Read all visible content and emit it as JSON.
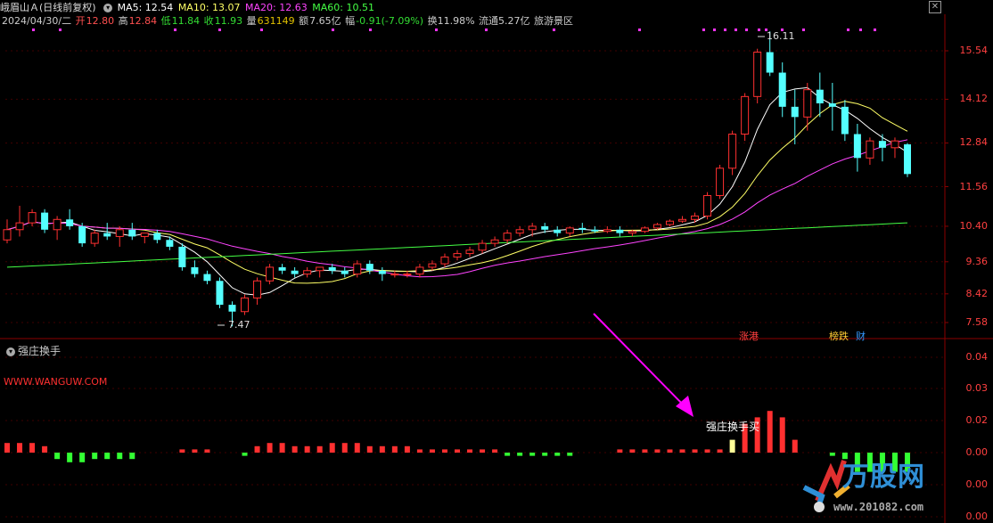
{
  "header": {
    "stock_name": "峨眉山Ａ(日线前复权)",
    "ma5": "MA5: 12.54",
    "ma10": "MA10: 13.07",
    "ma20": "MA20: 12.63",
    "ma60": "MA60: 10.51",
    "close_symbol": "✕"
  },
  "info": {
    "date": "2024/04/30/二",
    "open_label": "开",
    "open": "12.80",
    "high_label": "高",
    "high": "12.84",
    "low_label": "低",
    "low": "11.84",
    "close_label": "收",
    "close": "11.93",
    "volume_label": "量",
    "volume": "631149",
    "amount_label": "额",
    "amount": "7.65亿",
    "change_label": "幅",
    "change": "-0.91(-7.09%)",
    "turnover": "换11.98%",
    "float": "流通5.27亿",
    "sector": "旅游景区"
  },
  "price_axis": [
    "15.54",
    "14.12",
    "12.84",
    "11.56",
    "10.40",
    "9.36",
    "8.42",
    "7.58"
  ],
  "indicator_axis": [
    "0.04",
    "0.03",
    "0.02",
    "0.00",
    "0.00",
    "0.00"
  ],
  "annotations": {
    "high_marker": "16.11",
    "low_marker": "7.47",
    "badge_zt": "涨港",
    "badge_bd": "榜跌",
    "badge_cai": "财",
    "buy_signal": "强庄换手买"
  },
  "indicator": {
    "name": "强庄换手",
    "url": "WWW.WANGUW.COM"
  },
  "watermark": {
    "brand": "万股网",
    "url": "www.201082.com"
  },
  "colors": {
    "up": "#ff3030",
    "down": "#54ffff",
    "ma5": "#ffffff",
    "ma10": "#ffff66",
    "ma20": "#ff44ff",
    "ma60": "#44ff44",
    "grid": "#8b0000"
  },
  "candles": [
    [
      10.0,
      10.6,
      9.9,
      10.3
    ],
    [
      10.3,
      11.0,
      10.1,
      10.5
    ],
    [
      10.5,
      10.9,
      10.4,
      10.8
    ],
    [
      10.8,
      10.9,
      10.2,
      10.3
    ],
    [
      10.3,
      10.7,
      10.0,
      10.6
    ],
    [
      10.6,
      10.9,
      10.3,
      10.4
    ],
    [
      10.4,
      10.5,
      9.8,
      9.9
    ],
    [
      9.9,
      10.3,
      9.8,
      10.2
    ],
    [
      10.2,
      10.5,
      10.0,
      10.1
    ],
    [
      10.1,
      10.4,
      9.8,
      10.3
    ],
    [
      10.3,
      10.5,
      10.0,
      10.1
    ],
    [
      10.1,
      10.2,
      9.9,
      10.2
    ],
    [
      10.2,
      10.3,
      9.9,
      10.0
    ],
    [
      10.0,
      10.1,
      9.7,
      9.8
    ],
    [
      9.8,
      9.9,
      9.1,
      9.2
    ],
    [
      9.2,
      9.4,
      8.9,
      9.0
    ],
    [
      9.0,
      9.1,
      8.7,
      8.8
    ],
    [
      8.8,
      8.9,
      8.0,
      8.1
    ],
    [
      8.1,
      8.2,
      7.47,
      7.9
    ],
    [
      7.9,
      8.4,
      7.8,
      8.3
    ],
    [
      8.3,
      8.9,
      8.1,
      8.8
    ],
    [
      8.8,
      9.3,
      8.7,
      9.2
    ],
    [
      9.2,
      9.3,
      9.0,
      9.1
    ],
    [
      9.1,
      9.2,
      8.9,
      9.0
    ],
    [
      9.0,
      9.2,
      8.9,
      9.1
    ],
    [
      9.1,
      9.2,
      8.9,
      9.2
    ],
    [
      9.2,
      9.3,
      9.0,
      9.1
    ],
    [
      9.1,
      9.2,
      8.9,
      9.0
    ],
    [
      9.0,
      9.4,
      8.9,
      9.3
    ],
    [
      9.3,
      9.4,
      9.0,
      9.1
    ],
    [
      9.1,
      9.2,
      8.8,
      9.0
    ],
    [
      9.0,
      9.1,
      8.9,
      9.0
    ],
    [
      9.0,
      9.1,
      8.9,
      9.0
    ],
    [
      9.0,
      9.3,
      8.9,
      9.2
    ],
    [
      9.2,
      9.4,
      9.1,
      9.3
    ],
    [
      9.3,
      9.6,
      9.2,
      9.5
    ],
    [
      9.5,
      9.7,
      9.4,
      9.6
    ],
    [
      9.6,
      9.8,
      9.5,
      9.7
    ],
    [
      9.7,
      10.0,
      9.6,
      9.9
    ],
    [
      9.9,
      10.1,
      9.8,
      10.0
    ],
    [
      10.0,
      10.3,
      9.9,
      10.2
    ],
    [
      10.2,
      10.4,
      10.1,
      10.3
    ],
    [
      10.3,
      10.5,
      10.1,
      10.4
    ],
    [
      10.4,
      10.5,
      10.2,
      10.3
    ],
    [
      10.3,
      10.4,
      10.1,
      10.2
    ],
    [
      10.2,
      10.4,
      10.1,
      10.35
    ],
    [
      10.35,
      10.5,
      10.2,
      10.3
    ],
    [
      10.3,
      10.4,
      10.2,
      10.25
    ],
    [
      10.25,
      10.4,
      10.2,
      10.3
    ],
    [
      10.3,
      10.4,
      10.1,
      10.2
    ],
    [
      10.2,
      10.3,
      10.1,
      10.25
    ],
    [
      10.25,
      10.4,
      10.2,
      10.35
    ],
    [
      10.35,
      10.5,
      10.3,
      10.45
    ],
    [
      10.45,
      10.6,
      10.4,
      10.55
    ],
    [
      10.55,
      10.7,
      10.5,
      10.6
    ],
    [
      10.6,
      10.8,
      10.5,
      10.7
    ],
    [
      10.7,
      11.4,
      10.6,
      11.3
    ],
    [
      11.3,
      12.2,
      11.2,
      12.1
    ],
    [
      12.1,
      13.2,
      11.9,
      13.1
    ],
    [
      13.1,
      14.3,
      12.9,
      14.2
    ],
    [
      14.2,
      15.6,
      14.0,
      15.5
    ],
    [
      15.5,
      16.11,
      14.8,
      14.9
    ],
    [
      14.9,
      15.2,
      13.6,
      13.9
    ],
    [
      13.9,
      14.4,
      12.8,
      13.6
    ],
    [
      13.6,
      14.6,
      13.2,
      14.4
    ],
    [
      14.4,
      14.9,
      13.6,
      14.0
    ],
    [
      14.0,
      14.6,
      13.2,
      13.9
    ],
    [
      13.9,
      14.1,
      12.9,
      13.1
    ],
    [
      13.1,
      13.4,
      12.0,
      12.4
    ],
    [
      12.4,
      13.0,
      12.2,
      12.9
    ],
    [
      12.9,
      13.1,
      12.3,
      12.7
    ],
    [
      12.7,
      13.0,
      12.4,
      12.9
    ],
    [
      12.8,
      12.84,
      11.84,
      11.93
    ]
  ],
  "signals": [
    0.003,
    0.003,
    0.003,
    0.002,
    -0.002,
    -0.003,
    -0.003,
    -0.002,
    -0.002,
    -0.002,
    -0.002,
    0.0,
    0.0,
    0.0,
    0.001,
    0.001,
    0.001,
    0.0,
    0.0,
    -0.001,
    0.002,
    0.003,
    0.003,
    0.002,
    0.002,
    0.002,
    0.003,
    0.003,
    0.003,
    0.002,
    0.002,
    0.002,
    0.002,
    0.001,
    0.001,
    0.001,
    0.001,
    0.001,
    0.001,
    0.001,
    -0.001,
    -0.001,
    -0.001,
    -0.001,
    -0.001,
    -0.001,
    0.0,
    0.0,
    0.0,
    0.001,
    0.001,
    0.001,
    0.001,
    0.001,
    0.001,
    0.001,
    0.001,
    0.001,
    0.004,
    0.009,
    0.011,
    0.013,
    0.011,
    0.004,
    0.0,
    0.0,
    -0.001,
    -0.002,
    -0.006,
    -0.006,
    -0.006,
    -0.006,
    -0.006
  ]
}
